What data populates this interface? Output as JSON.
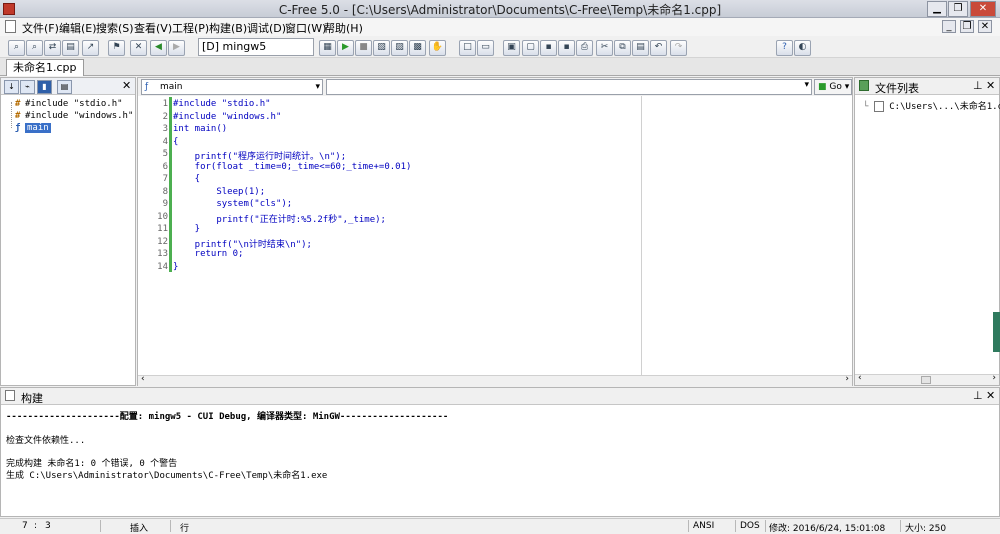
{
  "window": {
    "title": "C-Free 5.0 - [C:\\Users\\Administrator\\Documents\\C-Free\\Temp\\未命名1.cpp]"
  },
  "menu": [
    "文件(F)",
    "编辑(E)",
    "搜索(S)",
    "查看(V)",
    "工程(P)",
    "构建(B)",
    "调试(D)",
    "窗口(W)",
    "帮助(H)"
  ],
  "toolbar": {
    "compiler": "[D] mingw5"
  },
  "tabs": [
    "未命名1.cpp"
  ],
  "symbols": {
    "items": [
      "#include \"stdio.h\"",
      "#include \"windows.h\"",
      "main"
    ]
  },
  "editor": {
    "function_select": "main",
    "go_label": "Go",
    "line_numbers": [
      "1",
      "2",
      "3",
      "4",
      "5",
      "6",
      "7",
      "8",
      "9",
      "10",
      "11",
      "12",
      "13",
      "14"
    ],
    "lines": [
      "#include \"stdio.h\"",
      "#include \"windows.h\"",
      "int main()",
      "{",
      "    printf(\"程序运行时间统计。\\n\");",
      "    for(float _time=0;_time<=60;_time+=0.01)",
      "    {",
      "        Sleep(1);",
      "        system(\"cls\");",
      "        printf(\"正在计时:%5.2f秒\",_time);",
      "    }",
      "    printf(\"\\n计时结束\\n\");",
      "    return 0;",
      "}"
    ]
  },
  "file_list": {
    "title": "文件列表",
    "items": [
      "C:\\Users\\...\\未命名1.cpp"
    ]
  },
  "build": {
    "title": "构建",
    "lines": [
      "---------------------配置: mingw5 - CUI Debug, 编译器类型: MinGW--------------------",
      "",
      "检查文件依赖性...",
      "",
      "完成构建 未命名1: 0 个错误, 0 个警告",
      "生成 C:\\Users\\Administrator\\Documents\\C-Free\\Temp\\未命名1.exe"
    ]
  },
  "status": {
    "line": "7",
    "col": "3",
    "mode": "插入",
    "unit": "行",
    "encoding": "ANSI",
    "eol": "DOS",
    "modified": "修改: 2016/6/24, 15:01:08",
    "size": "大小: 250"
  }
}
